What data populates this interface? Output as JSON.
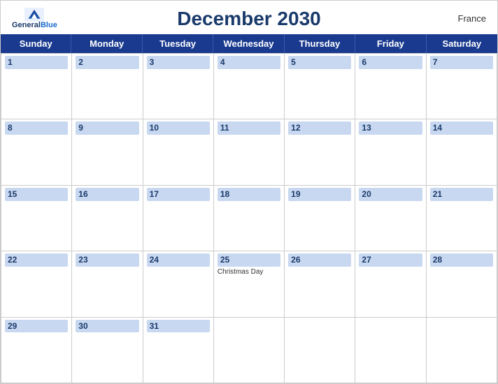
{
  "header": {
    "title": "December 2030",
    "country": "France",
    "logo": {
      "general": "General",
      "blue": "Blue"
    }
  },
  "days": [
    "Sunday",
    "Monday",
    "Tuesday",
    "Wednesday",
    "Thursday",
    "Friday",
    "Saturday"
  ],
  "weeks": [
    [
      {
        "date": "1",
        "events": []
      },
      {
        "date": "2",
        "events": []
      },
      {
        "date": "3",
        "events": []
      },
      {
        "date": "4",
        "events": []
      },
      {
        "date": "5",
        "events": []
      },
      {
        "date": "6",
        "events": []
      },
      {
        "date": "7",
        "events": []
      }
    ],
    [
      {
        "date": "8",
        "events": []
      },
      {
        "date": "9",
        "events": []
      },
      {
        "date": "10",
        "events": []
      },
      {
        "date": "11",
        "events": []
      },
      {
        "date": "12",
        "events": []
      },
      {
        "date": "13",
        "events": []
      },
      {
        "date": "14",
        "events": []
      }
    ],
    [
      {
        "date": "15",
        "events": []
      },
      {
        "date": "16",
        "events": []
      },
      {
        "date": "17",
        "events": []
      },
      {
        "date": "18",
        "events": []
      },
      {
        "date": "19",
        "events": []
      },
      {
        "date": "20",
        "events": []
      },
      {
        "date": "21",
        "events": []
      }
    ],
    [
      {
        "date": "22",
        "events": []
      },
      {
        "date": "23",
        "events": []
      },
      {
        "date": "24",
        "events": []
      },
      {
        "date": "25",
        "events": [
          "Christmas Day"
        ]
      },
      {
        "date": "26",
        "events": []
      },
      {
        "date": "27",
        "events": []
      },
      {
        "date": "28",
        "events": []
      }
    ],
    [
      {
        "date": "29",
        "events": []
      },
      {
        "date": "30",
        "events": []
      },
      {
        "date": "31",
        "events": []
      },
      {
        "date": "",
        "events": []
      },
      {
        "date": "",
        "events": []
      },
      {
        "date": "",
        "events": []
      },
      {
        "date": "",
        "events": []
      }
    ]
  ]
}
